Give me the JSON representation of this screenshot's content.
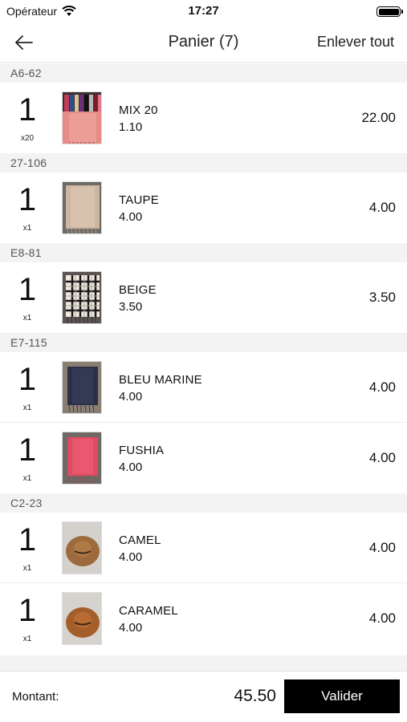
{
  "status_bar": {
    "carrier": "Opérateur",
    "time": "17:27"
  },
  "nav": {
    "title": "Panier (7)",
    "clear_all": "Enlever tout"
  },
  "groups": [
    {
      "code": "A6-62",
      "items": [
        {
          "qty": "1",
          "mult": "x20",
          "name": "MIX 20",
          "unit_price": "1.10",
          "total": "22.00",
          "image": "multi-scarves-image"
        }
      ]
    },
    {
      "code": "27-106",
      "items": [
        {
          "qty": "1",
          "mult": "x1",
          "name": "TAUPE",
          "unit_price": "4.00",
          "total": "4.00",
          "image": "taupe-scarf-image"
        }
      ]
    },
    {
      "code": "E8-81",
      "items": [
        {
          "qty": "1",
          "mult": "x1",
          "name": "BEIGE",
          "unit_price": "3.50",
          "total": "3.50",
          "image": "plaid-scarf-image"
        }
      ]
    },
    {
      "code": "E7-115",
      "items": [
        {
          "qty": "1",
          "mult": "x1",
          "name": "BLEU MARINE",
          "unit_price": "4.00",
          "total": "4.00",
          "image": "navy-scarf-image"
        },
        {
          "qty": "1",
          "mult": "x1",
          "name": "FUSHIA",
          "unit_price": "4.00",
          "total": "4.00",
          "image": "fuchsia-scarf-image"
        }
      ]
    },
    {
      "code": "C2-23",
      "items": [
        {
          "qty": "1",
          "mult": "x1",
          "name": "CAMEL",
          "unit_price": "4.00",
          "total": "4.00",
          "image": "camel-hat-image"
        },
        {
          "qty": "1",
          "mult": "x1",
          "name": "CARAMEL",
          "unit_price": "4.00",
          "total": "4.00",
          "image": "caramel-hat-image"
        }
      ]
    }
  ],
  "footer": {
    "amount_label": "Montant:",
    "amount_value": "45.50",
    "validate_label": "Valider"
  },
  "colors": {
    "header_bg": "#f3f3f3",
    "button_bg": "#000000",
    "button_text": "#ffffff"
  }
}
